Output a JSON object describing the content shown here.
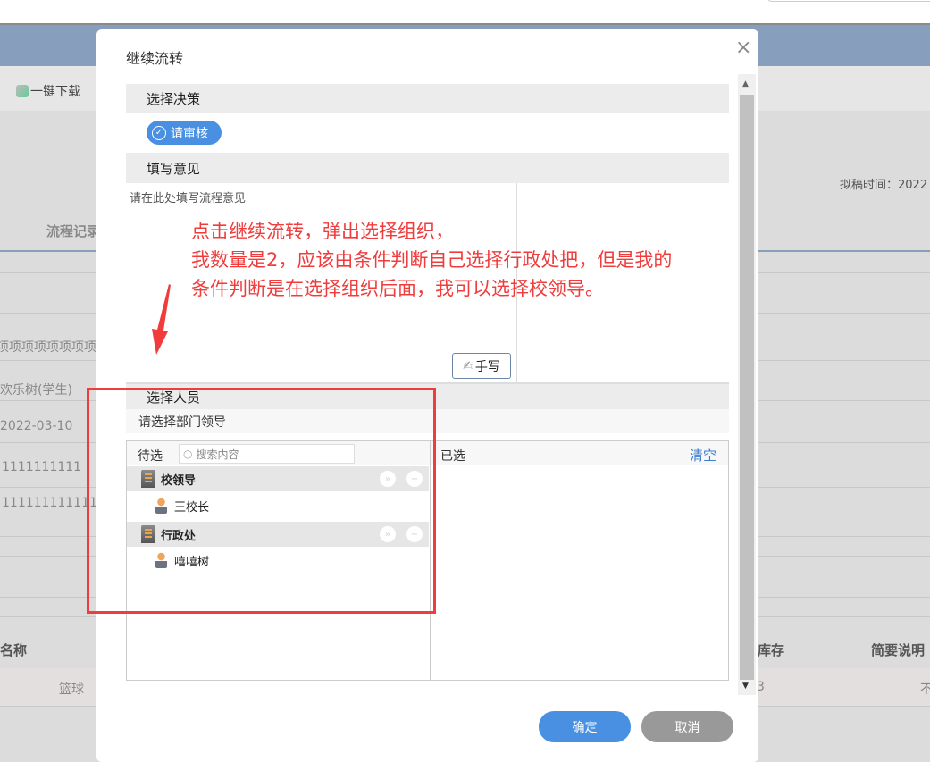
{
  "background": {
    "toolbar_download": "一键下载",
    "flow_record": "流程记录",
    "draft_time": "拟稿时间：2022",
    "rows": [
      "项项项项项项项项",
      "欢乐树(学生)",
      "2022-03-10",
      "1111111111",
      "1111111111111"
    ],
    "table_headers": [
      "名称",
      "库存",
      "简要说明"
    ],
    "table_row": [
      "篮球",
      "3",
      "不"
    ]
  },
  "dialog": {
    "title": "继续流转",
    "close": "×",
    "decision_header": "选择决策",
    "decision_option": "请审核",
    "opinion_header": "填写意见",
    "opinion_placeholder": "请在此处填写流程意见",
    "handwrite": "手写",
    "people_header": "选择人员",
    "people_hint": "请选择部门领导",
    "pending_label": "待选",
    "search_placeholder": "搜索内容",
    "selected_label": "已选",
    "clear": "清空",
    "groups": [
      {
        "name": "校领导",
        "members": [
          "王校长"
        ]
      },
      {
        "name": "行政处",
        "members": [
          "嘻嘻树"
        ]
      }
    ],
    "confirm": "确定",
    "cancel": "取消"
  },
  "annotation": {
    "lines": [
      "点击继续流转，弹出选择组织，",
      "我数量是2，应该由条件判断自己选择行政处把，但是我的",
      "条件判断是在选择组织后面，我可以选择校领导。"
    ],
    "color": "#f03c3c"
  },
  "colors": {
    "primary": "#4a90e2",
    "cancel": "#999999",
    "link": "#3a7dd0"
  }
}
